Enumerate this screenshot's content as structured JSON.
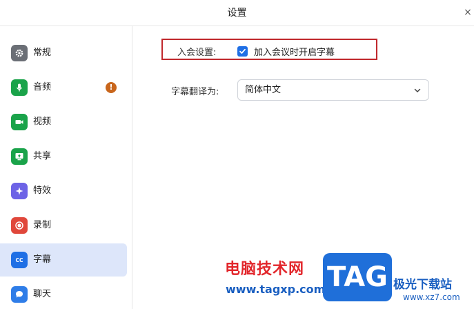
{
  "window": {
    "title": "设置",
    "close_glyph": "×"
  },
  "sidebar": {
    "items": [
      {
        "label": "常规",
        "icon": "gear-icon",
        "color": "#6b6f76",
        "active": false
      },
      {
        "label": "音频",
        "icon": "microphone-icon",
        "color": "#1aa34a",
        "active": false,
        "badge": "!"
      },
      {
        "label": "视频",
        "icon": "video-camera-icon",
        "color": "#1aa34a",
        "active": false
      },
      {
        "label": "共享",
        "icon": "share-screen-icon",
        "color": "#1aa34a",
        "active": false
      },
      {
        "label": "特效",
        "icon": "effects-icon",
        "color": "#6d63e6",
        "active": false
      },
      {
        "label": "录制",
        "icon": "record-icon",
        "color": "#e0473b",
        "active": false
      },
      {
        "label": "字幕",
        "icon": "cc-icon",
        "color": "#1f6fe5",
        "active": true
      },
      {
        "label": "聊天",
        "icon": "chat-icon",
        "color": "#2f7de8",
        "active": false
      }
    ]
  },
  "main": {
    "join_setting_label": "入会设置:",
    "join_checkbox_label": "加入会议时开启字幕",
    "join_checkbox_checked": true,
    "translate_label": "字幕翻译为:",
    "translate_value": "简体中文"
  },
  "watermark": {
    "cn_text": "电脑技术网",
    "url": "www.tagxp.com",
    "logo_text": "TAG",
    "site_cn": "极光下载站",
    "site_url": "www.xz7.com"
  },
  "colors": {
    "accent": "#1f6fe5",
    "active_bg": "#dde6fa",
    "highlight": "#c0282d"
  }
}
